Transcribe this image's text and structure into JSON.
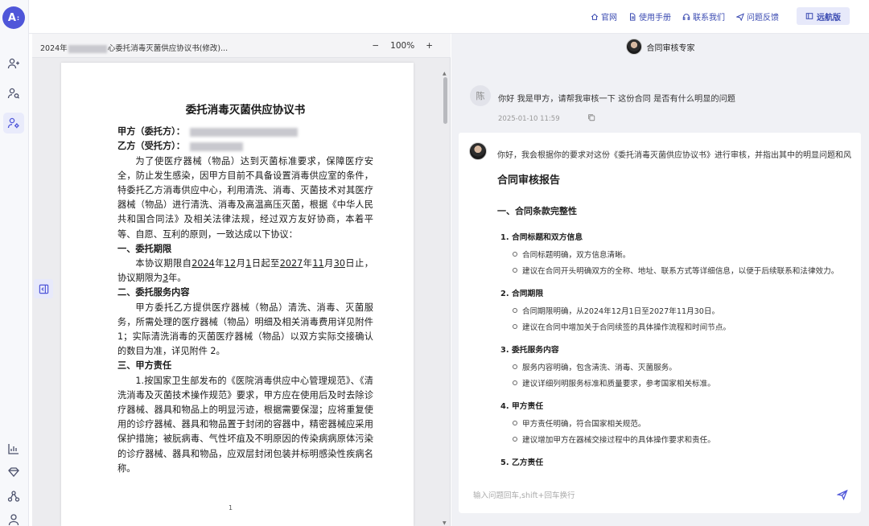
{
  "app": {
    "logo_text": "A"
  },
  "topbar": {
    "links": [
      {
        "label": "官网",
        "icon": "home-icon"
      },
      {
        "label": "使用手册",
        "icon": "document-icon"
      },
      {
        "label": "联系我们",
        "icon": "headset-icon"
      },
      {
        "label": "问题反馈",
        "icon": "send-icon"
      }
    ],
    "version_button": "远航版"
  },
  "document": {
    "file_name_prefix": "2024年",
    "file_name_suffix": "心委托消毒灭菌供应协议书(修改)...",
    "zoom_minus": "−",
    "zoom_level": "100%",
    "zoom_plus": "+",
    "title": "委托消毒灭菌供应协议书",
    "party_a": "甲方（委托方）：",
    "party_b": "乙方（受托方）：",
    "intro": "为了使医疗器械（物品）达到灭菌标准要求，保障医疗安全，防止发生感染，因甲方目前不具备设置消毒供应室的条件，特委托乙方消毒供应中心，利用清洗、消毒、灭菌技术对其医疗器械（物品）进行清洗、消毒及高温高压灭菌，根据《中华人民共和国合同法》及相关法律法规，经过双方友好协商，本着平等、自愿、互利的原则，一致达成以下协议：",
    "sec1_title": "一、委托期限",
    "sec1_text_a": "本协议期限自",
    "sec1_y1": "2024",
    "sec1_t1": "年",
    "sec1_m1": "12",
    "sec1_t2": "月",
    "sec1_d1": "1",
    "sec1_t3": "日起至",
    "sec1_y2": "2027",
    "sec1_t4": "年",
    "sec1_m2": "11",
    "sec1_t5": "月",
    "sec1_d2": "30",
    "sec1_t6": "日止，协议期限为",
    "sec1_years": "3",
    "sec1_t7": "年。",
    "sec2_title": "二、委托服务内容",
    "sec2_text": "甲方委托乙方提供医疗器械（物品）清洗、消毒、灭菌服务，所需处理的医疗器械（物品）明细及相关消毒费用详见附件 1；实际清洗消毒的灭菌医疗器械（物品）以双方实际交接确认的数目为准，详见附件 2。",
    "sec3_title": "三、甲方责任",
    "sec3_text": "1.按国家卫生部发布的《医院消毒供应中心管理规范》、《清洗消毒及灭菌技术操作规范》要求，甲方应在使用后及时去除诊疗器械、器具和物品上的明显污迹，根据需要保湿；应将重复使用的诊疗器械、器具和物品置于封闭的容器中，精密器械应采用保护措施；被朊病毒、气性坏疽及不明原因的传染病病原体污染的诊疗器械、器具和物品，应双层封闭包装并标明感染性疾病名称。",
    "page_number": "1"
  },
  "chat": {
    "header_title": "合同审核专家",
    "user_avatar_text": "陈",
    "user_message": "你好  我是甲方，请帮我审核一下  这份合同 是否有什么明显的问题",
    "user_timestamp": "2025-01-10 11:59",
    "ai_intro": "你好，我会根据你的要求对这份《委托消毒灭菌供应协议书》进行审核，并指出其中的明显问题和风",
    "report_title": "合同审核报告",
    "section_title": "一、合同条款完整性",
    "items": [
      {
        "title": "1. 合同标题和双方信息",
        "bullets": [
          "合同标题明确，双方信息清晰。",
          "建议在合同开头明确双方的全称、地址、联系方式等详细信息，以便于后续联系和法律效力。"
        ]
      },
      {
        "title": "2. 合同期限",
        "bullets": [
          "合同期限明确，从2024年12月1日至2027年11月30日。",
          "建议在合同中增加关于合同续签的具体操作流程和时间节点。"
        ]
      },
      {
        "title": "3. 委托服务内容",
        "bullets": [
          "服务内容明确，包含清洗、消毒、灭菌服务。",
          "建议详细列明服务标准和质量要求，参考国家相关标准。"
        ]
      },
      {
        "title": "4. 甲方责任",
        "bullets": [
          "甲方责任明确，符合国家相关规范。",
          "建议增加甲方在器械交接过程中的具体操作要求和责任。"
        ]
      },
      {
        "title": "5. 乙方责任",
        "bullets": []
      }
    ],
    "input_placeholder": "输入问题回车,shift+回车换行"
  },
  "colors": {
    "accent": "#4f56d9",
    "link": "#3b4bb2",
    "chat_bg": "#f0f1f5"
  }
}
